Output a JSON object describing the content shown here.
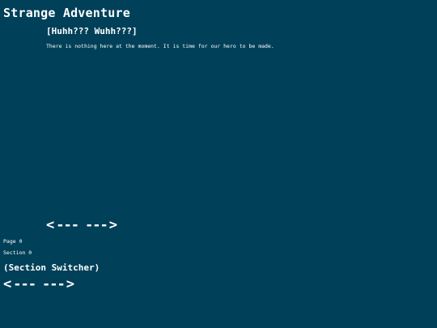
{
  "app": {
    "title": "Strange Adventure"
  },
  "content": {
    "heading": "[Huhh??? Wuhh???]",
    "message": "There is nothing here at the moment. It is time for our hero to be made."
  },
  "page_nav": {
    "prev_label": "<",
    "dashes_left": "---",
    "dashes_right": "---",
    "next_label": ">"
  },
  "status": {
    "page": "Page 0",
    "section": "Section 0"
  },
  "section_switcher": {
    "title": "(Section Switcher)",
    "prev_label": "<",
    "dashes_left": "---",
    "dashes_right": "---",
    "next_label": ">"
  }
}
